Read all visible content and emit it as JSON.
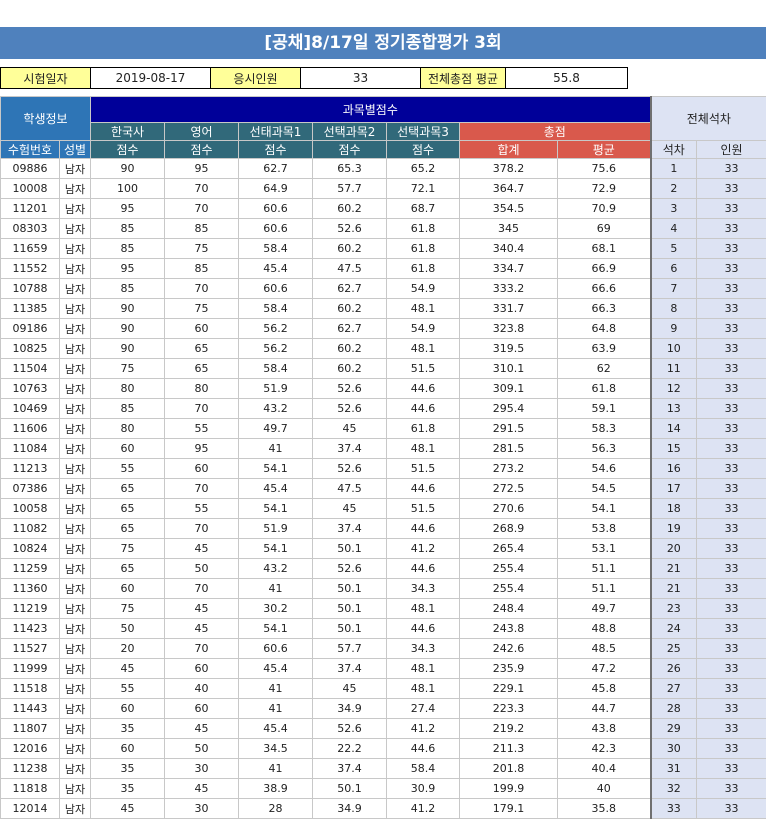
{
  "title": "[공채]8/17일 정기종합평가 3회",
  "info": {
    "date_label": "시험일자",
    "date_value": "2019-08-17",
    "count_label": "응시인원",
    "count_value": "33",
    "avg_label": "전체총점 평균",
    "avg_value": "55.8"
  },
  "headers": {
    "student_info": "학생정보",
    "subject_scores": "과목별점수",
    "overall_rank": "전체석차",
    "subjects": [
      "한국사",
      "영어",
      "선태과목1",
      "선택과목2",
      "선택과목3"
    ],
    "total_group": "총점",
    "score_label": "점수",
    "sum_label": "합계",
    "avg_label": "평균",
    "exam_no": "수험번호",
    "gender": "성별",
    "rank": "석차",
    "people": "인원"
  },
  "rows": [
    [
      "09886",
      "남자",
      "90",
      "95",
      "62.7",
      "65.3",
      "65.2",
      "378.2",
      "75.6",
      "1",
      "33"
    ],
    [
      "10008",
      "남자",
      "100",
      "70",
      "64.9",
      "57.7",
      "72.1",
      "364.7",
      "72.9",
      "2",
      "33"
    ],
    [
      "11201",
      "남자",
      "95",
      "70",
      "60.6",
      "60.2",
      "68.7",
      "354.5",
      "70.9",
      "3",
      "33"
    ],
    [
      "08303",
      "남자",
      "85",
      "85",
      "60.6",
      "52.6",
      "61.8",
      "345",
      "69",
      "4",
      "33"
    ],
    [
      "11659",
      "남자",
      "85",
      "75",
      "58.4",
      "60.2",
      "61.8",
      "340.4",
      "68.1",
      "5",
      "33"
    ],
    [
      "11552",
      "남자",
      "95",
      "85",
      "45.4",
      "47.5",
      "61.8",
      "334.7",
      "66.9",
      "6",
      "33"
    ],
    [
      "10788",
      "남자",
      "85",
      "70",
      "60.6",
      "62.7",
      "54.9",
      "333.2",
      "66.6",
      "7",
      "33"
    ],
    [
      "11385",
      "남자",
      "90",
      "75",
      "58.4",
      "60.2",
      "48.1",
      "331.7",
      "66.3",
      "8",
      "33"
    ],
    [
      "09186",
      "남자",
      "90",
      "60",
      "56.2",
      "62.7",
      "54.9",
      "323.8",
      "64.8",
      "9",
      "33"
    ],
    [
      "10825",
      "남자",
      "90",
      "65",
      "56.2",
      "60.2",
      "48.1",
      "319.5",
      "63.9",
      "10",
      "33"
    ],
    [
      "11504",
      "남자",
      "75",
      "65",
      "58.4",
      "60.2",
      "51.5",
      "310.1",
      "62",
      "11",
      "33"
    ],
    [
      "10763",
      "남자",
      "80",
      "80",
      "51.9",
      "52.6",
      "44.6",
      "309.1",
      "61.8",
      "12",
      "33"
    ],
    [
      "10469",
      "남자",
      "85",
      "70",
      "43.2",
      "52.6",
      "44.6",
      "295.4",
      "59.1",
      "13",
      "33"
    ],
    [
      "11606",
      "남자",
      "80",
      "55",
      "49.7",
      "45",
      "61.8",
      "291.5",
      "58.3",
      "14",
      "33"
    ],
    [
      "11084",
      "남자",
      "60",
      "95",
      "41",
      "37.4",
      "48.1",
      "281.5",
      "56.3",
      "15",
      "33"
    ],
    [
      "11213",
      "남자",
      "55",
      "60",
      "54.1",
      "52.6",
      "51.5",
      "273.2",
      "54.6",
      "16",
      "33"
    ],
    [
      "07386",
      "남자",
      "65",
      "70",
      "45.4",
      "47.5",
      "44.6",
      "272.5",
      "54.5",
      "17",
      "33"
    ],
    [
      "10058",
      "남자",
      "65",
      "55",
      "54.1",
      "45",
      "51.5",
      "270.6",
      "54.1",
      "18",
      "33"
    ],
    [
      "11082",
      "남자",
      "65",
      "70",
      "51.9",
      "37.4",
      "44.6",
      "268.9",
      "53.8",
      "19",
      "33"
    ],
    [
      "10824",
      "남자",
      "75",
      "45",
      "54.1",
      "50.1",
      "41.2",
      "265.4",
      "53.1",
      "20",
      "33"
    ],
    [
      "11259",
      "남자",
      "65",
      "50",
      "43.2",
      "52.6",
      "44.6",
      "255.4",
      "51.1",
      "21",
      "33"
    ],
    [
      "11360",
      "남자",
      "60",
      "70",
      "41",
      "50.1",
      "34.3",
      "255.4",
      "51.1",
      "21",
      "33"
    ],
    [
      "11219",
      "남자",
      "75",
      "45",
      "30.2",
      "50.1",
      "48.1",
      "248.4",
      "49.7",
      "23",
      "33"
    ],
    [
      "11423",
      "남자",
      "50",
      "45",
      "54.1",
      "50.1",
      "44.6",
      "243.8",
      "48.8",
      "24",
      "33"
    ],
    [
      "11527",
      "남자",
      "20",
      "70",
      "60.6",
      "57.7",
      "34.3",
      "242.6",
      "48.5",
      "25",
      "33"
    ],
    [
      "11999",
      "남자",
      "45",
      "60",
      "45.4",
      "37.4",
      "48.1",
      "235.9",
      "47.2",
      "26",
      "33"
    ],
    [
      "11518",
      "남자",
      "55",
      "40",
      "41",
      "45",
      "48.1",
      "229.1",
      "45.8",
      "27",
      "33"
    ],
    [
      "11443",
      "남자",
      "60",
      "60",
      "41",
      "34.9",
      "27.4",
      "223.3",
      "44.7",
      "28",
      "33"
    ],
    [
      "11807",
      "남자",
      "35",
      "45",
      "45.4",
      "52.6",
      "41.2",
      "219.2",
      "43.8",
      "29",
      "33"
    ],
    [
      "12016",
      "남자",
      "60",
      "50",
      "34.5",
      "22.2",
      "44.6",
      "211.3",
      "42.3",
      "30",
      "33"
    ],
    [
      "11238",
      "남자",
      "35",
      "30",
      "41",
      "37.4",
      "58.4",
      "201.8",
      "40.4",
      "31",
      "33"
    ],
    [
      "11818",
      "남자",
      "35",
      "45",
      "38.9",
      "50.1",
      "30.9",
      "199.9",
      "40",
      "32",
      "33"
    ],
    [
      "12014",
      "남자",
      "45",
      "30",
      "28",
      "34.9",
      "41.2",
      "179.1",
      "35.8",
      "33",
      "33"
    ]
  ]
}
